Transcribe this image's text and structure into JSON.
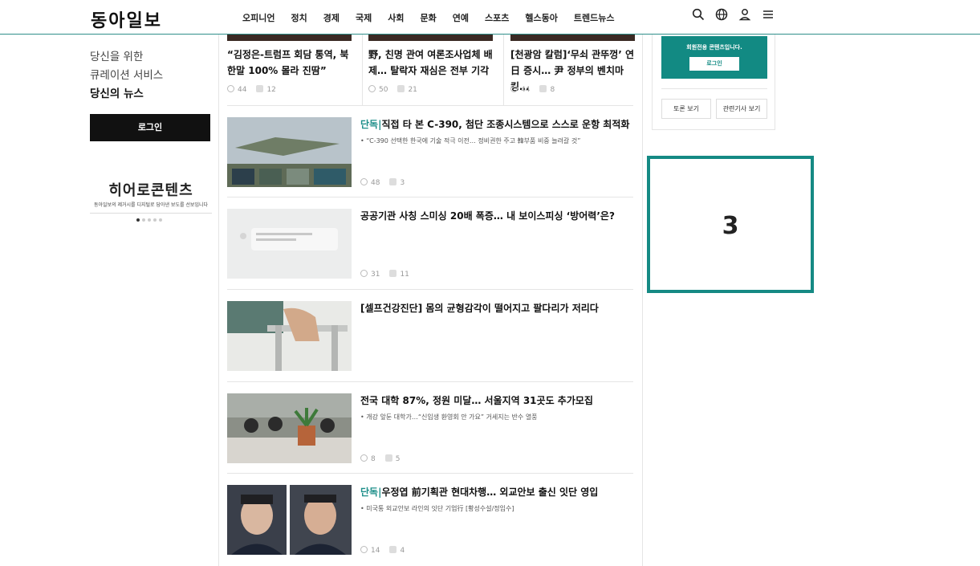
{
  "header": {
    "logo": "동아일보",
    "nav": [
      "오피니언",
      "정치",
      "경제",
      "국제",
      "사회",
      "문화",
      "연예",
      "스포츠",
      "헬스동아",
      "트렌드뉴스"
    ],
    "icons": [
      "search-icon",
      "globe-icon",
      "user-icon",
      "menu-icon"
    ]
  },
  "sidebar": {
    "line1": "당신을 위한",
    "line2": "큐레이션 서비스",
    "line3": "당신의 뉴스",
    "login": "로그인",
    "hero_title": "히어로콘텐츠",
    "hero_sub": "동아일보의 제거시를 디지털로 담아낸 보도를 선보입니다"
  },
  "top_articles": [
    {
      "title": "“김정은-트럼프 회담 통역, 북 한말 100% 몰라 진땀”",
      "views": "44",
      "comments": "12"
    },
    {
      "title": "野, 친명 관여 여론조사업체 배제… 탈락자 재심은 전부 기각",
      "views": "50",
      "comments": "21"
    },
    {
      "title": "[천광암 칼럼]‘무쇠 관뚜껑’ 연日 증시… 尹 정부의 벤치마킹…",
      "views": "44",
      "comments": "8"
    }
  ],
  "articles": [
    {
      "exclusive": "단독|",
      "title": "직접 타 본 C-390, 첨단 조종시스템으로 스스로 운항 최적화",
      "sub": "• “C-390 선택한 한국에 기술 적극 이전… 정비권한 주고 韓부품 비중 늘려갈 것”",
      "views": "48",
      "comments": "3"
    },
    {
      "exclusive": "",
      "title": "공공기관 사칭 스미싱 20배 폭증… 내 보이스피싱 ‘방어력’은?",
      "sub": "",
      "views": "31",
      "comments": "11"
    },
    {
      "exclusive": "",
      "title": "[셀프건강진단] 몸의 균형감각이 떨어지고 팔다리가 저리다",
      "sub": "",
      "views": "",
      "comments": ""
    },
    {
      "exclusive": "",
      "title": "전국 대학 87%, 정원 미달… 서울지역 31곳도 추가모집",
      "sub": "• 개강 앞둔 대학가…“신입생 환영회 안 가요” 거세지는 반수 열풍",
      "views": "8",
      "comments": "5"
    },
    {
      "exclusive": "단독|",
      "title": "우정엽 前기획관 현대차행… 외교안보 출신 잇단 영입",
      "sub": "• 미국통 외교안보 라인의 잇단 기업行 [황성수설/정임수]",
      "views": "14",
      "comments": "4"
    }
  ],
  "right": {
    "member_text": "회원전용 콘텐츠입니다.",
    "member_login": "로그인",
    "btn_discussion": "토론 보기",
    "btn_related": "관련기사 보기",
    "ad_number": "3"
  }
}
